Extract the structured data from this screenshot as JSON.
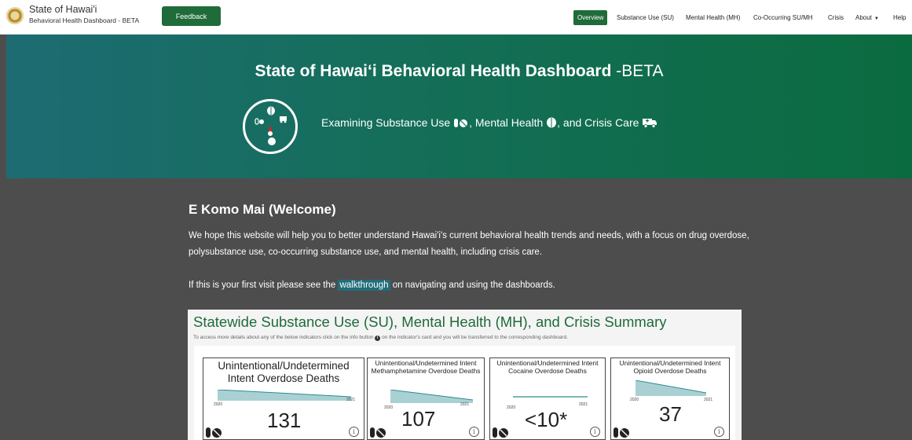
{
  "brand": {
    "title": "State of Hawai'i",
    "subtitle": "Behavioral Health Dashboard - BETA"
  },
  "feedback_label": "Feedback",
  "nav": [
    {
      "label": "Overview",
      "active": true
    },
    {
      "label": "Substance Use (SU)"
    },
    {
      "label": "Mental Health (MH)"
    },
    {
      "label": "Co-Occurring SU/MH"
    },
    {
      "label": "Crisis"
    },
    {
      "label": "About"
    },
    {
      "label": "Help"
    }
  ],
  "hero": {
    "title": "State of Hawaiʻi Behavioral Health Dashboard",
    "beta": "-BETA",
    "sub1": "Examining Substance Use",
    "sub2": ", Mental Health",
    "sub3": ", and Crisis Care",
    "colors": {
      "gradient_start": "#1d6c73",
      "gradient_end": "#0b6b3f"
    }
  },
  "welcome": {
    "title": "E Komo Mai (Welcome)",
    "paragraph": "We hope this website will help you to better understand Hawai'i's current behavioral health trends and needs, with a focus on drug overdose, polysubstance use, co-occurring substance use, and mental health, including crisis care.",
    "first_visit_pre": "If this is your first visit please see the",
    "walkthrough_link": "walkthrough",
    "first_visit_post": "on navigating and using the dashboards."
  },
  "summary": {
    "title": "Statewide Substance Use (SU), Mental Health (MH), and Crisis Summary",
    "note_pre": "To access more details about any of the below indicators click on the info button",
    "note_post": "on the indicator's card and you will be transferred to the corresponding dashboard.",
    "cards": [
      {
        "title": "Unintentional/Undetermined Intent Overdose Deaths",
        "value": "131",
        "year_start": "2020",
        "year_end": "2021"
      },
      {
        "title": "Unintentional/Undetermined Intent Methamphetamine Overdose Deaths",
        "value": "107",
        "year_start": "2020",
        "year_end": "2021"
      },
      {
        "title": "Unintentional/Undetermined Intent Cocaine Overdose Deaths",
        "value": "<10*",
        "year_start": "2020",
        "year_end": "2021"
      },
      {
        "title": "Unintentional/Undetermined Intent Opioid Overdose Deaths",
        "value": "37",
        "year_start": "2020",
        "year_end": "2021"
      }
    ],
    "accent_color": "#1f6b3a",
    "trend_color": "#a9d1d4"
  }
}
